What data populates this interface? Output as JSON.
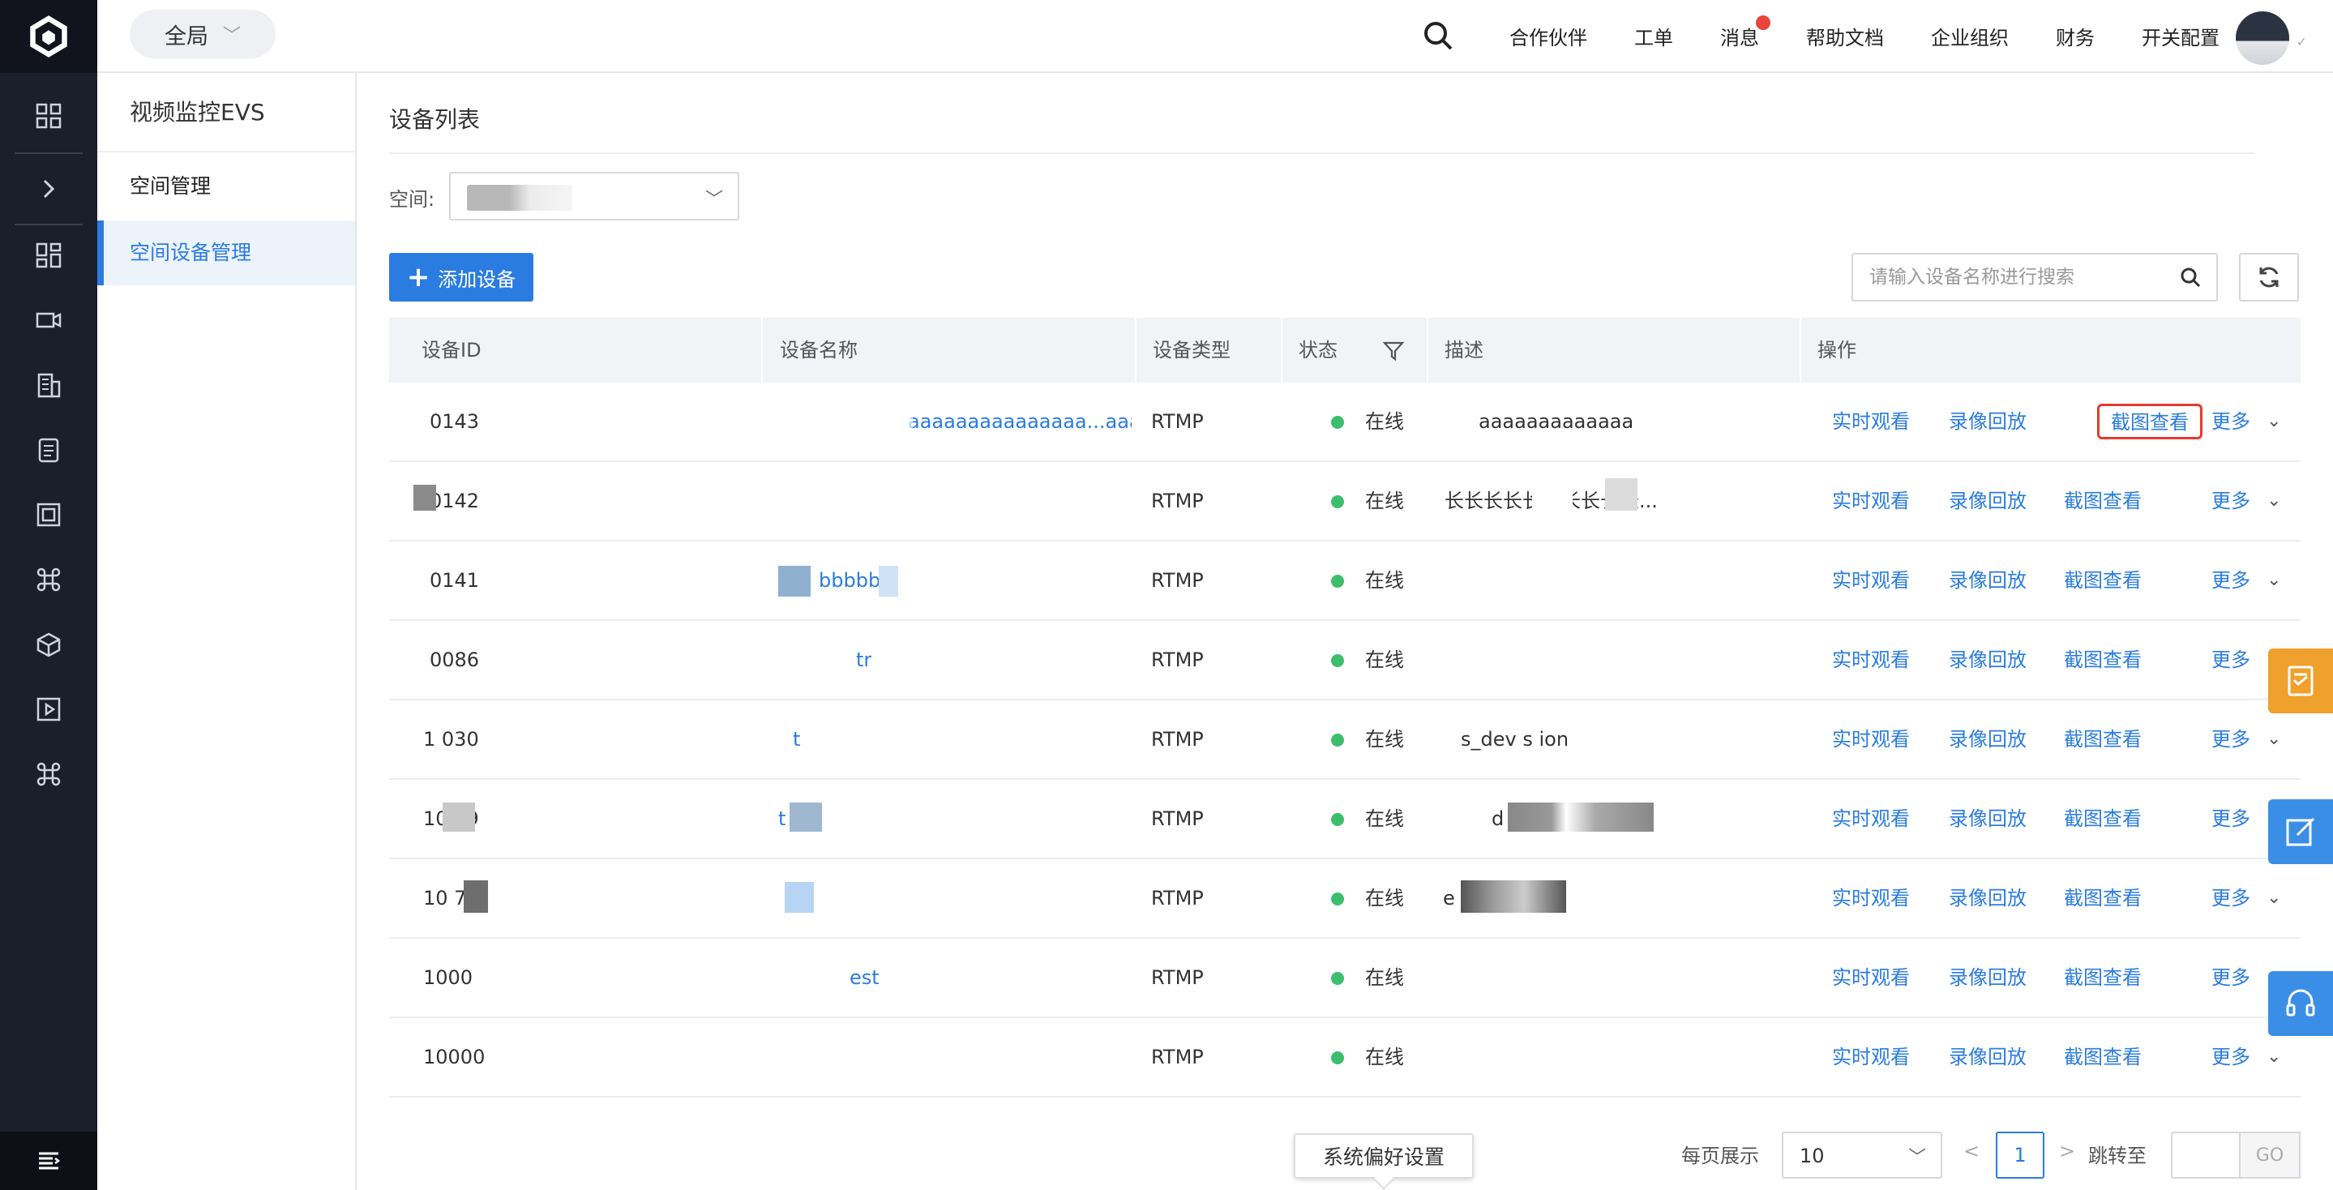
{
  "rail": {
    "icons": [
      "grid-icon",
      "chevron-right-icon",
      "dashboard-icon",
      "video-camera-icon",
      "building-icon",
      "storage-icon",
      "frame-icon",
      "command-icon",
      "cube-icon",
      "play-icon",
      "command-icon"
    ],
    "footer_icon": "menu-icon"
  },
  "topbar": {
    "scope_label": "全局",
    "nav": [
      "合作伙伴",
      "工单",
      "消息",
      "帮助文档",
      "企业组织",
      "财务",
      "开关配置"
    ]
  },
  "subnav": {
    "title": "视频监控EVS",
    "group": "空间管理",
    "active_item": "空间设备管理"
  },
  "main": {
    "title": "设备列表",
    "space_label": "空间:",
    "add_button": "添加设备",
    "search_placeholder": "请输入设备名称进行搜索"
  },
  "table": {
    "headers": [
      "设备ID",
      "设备名称",
      "设备类型",
      "状态",
      "描述",
      "操作"
    ],
    "rows": [
      {
        "id": "0143",
        "name": "aaaaaaaaaaaaaaa...aaaaaa...",
        "type": "RTMP",
        "status": "在线",
        "desc": "aaaaaaaaaaaaa"
      },
      {
        "id": "0142",
        "name": "",
        "type": "RTMP",
        "status": "在线",
        "desc": "长长长长长长长长长长..."
      },
      {
        "id": "0141",
        "name": "bbbbbb",
        "type": "RTMP",
        "status": "在线",
        "desc": ""
      },
      {
        "id": "0086",
        "name": "tr",
        "type": "RTMP",
        "status": "在线",
        "desc": ""
      },
      {
        "id": "1 030",
        "name": "t",
        "type": "RTMP",
        "status": "在线",
        "desc": "s_dev  s ion"
      },
      {
        "id": "10 29",
        "name": "t",
        "type": "RTMP",
        "status": "在线",
        "desc": "d  sc  n"
      },
      {
        "id": "10 7",
        "name": "",
        "type": "RTMP",
        "status": "在线",
        "desc": "e   cription"
      },
      {
        "id": "1000",
        "name": "est",
        "type": "RTMP",
        "status": "在线",
        "desc": ""
      },
      {
        "id": "10000",
        "name": "",
        "type": "RTMP",
        "status": "在线",
        "desc": ""
      }
    ],
    "actions": {
      "live": "实时观看",
      "playback": "录像回放",
      "snapshot": "截图查看",
      "more": "更多"
    }
  },
  "footer": {
    "prefs_label": "系统偏好设置",
    "page_size_label": "每页展示",
    "page_size": "10",
    "prev": "<",
    "current_page": "1",
    "next": ">",
    "jump_label": "跳转至",
    "go": "GO"
  },
  "colors": {
    "accent": "#2a7ce0",
    "online": "#3dbe6d",
    "highlight": "#e63a2e",
    "float_orange": "#f0a02c",
    "float_blue": "#3a8ee6"
  }
}
